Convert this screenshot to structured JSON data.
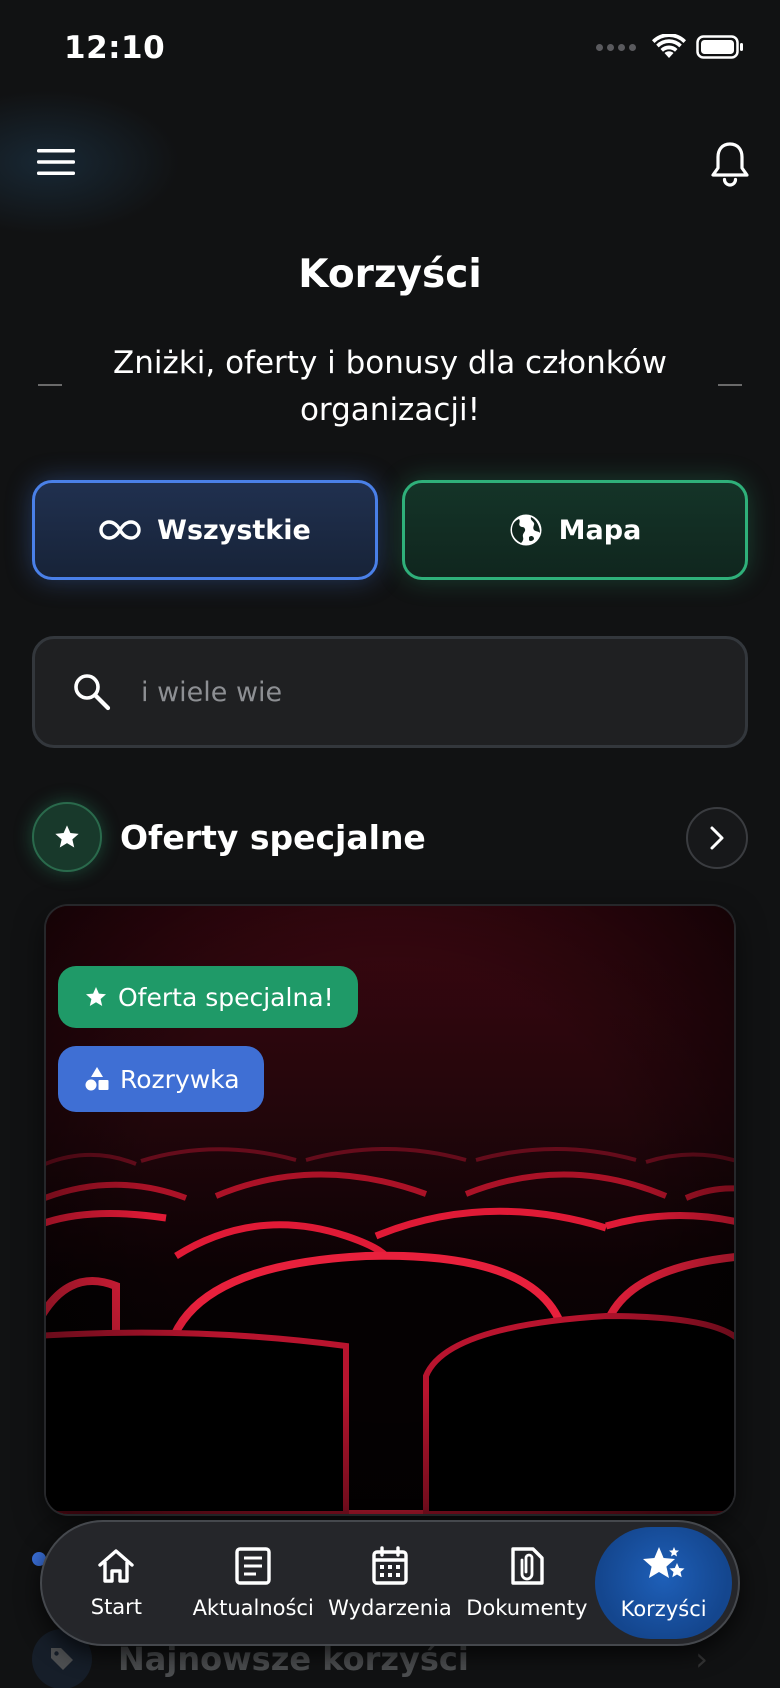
{
  "status_bar": {
    "time": "12:10"
  },
  "header": {
    "title": "Korzyści",
    "subtitle": "Zniżki, oferty i bonusy dla członków organizacji!"
  },
  "filters": {
    "all_label": "Wszystkie",
    "map_label": "Mapa"
  },
  "search": {
    "placeholder": "i wiele wie"
  },
  "special_section": {
    "title": "Oferty specjalne"
  },
  "offer_card": {
    "badge_special": "Oferta specjalna!",
    "badge_category": "Rozrywka",
    "category_icon": "shapes-icon",
    "image": "cinema-seats-red"
  },
  "next_section": {
    "title": "Najnowsze korzyści"
  },
  "nav": {
    "items": [
      {
        "label": "Start",
        "icon": "home-icon"
      },
      {
        "label": "Aktualności",
        "icon": "news-icon"
      },
      {
        "label": "Wydarzenia",
        "icon": "calendar-icon"
      },
      {
        "label": "Dokumenty",
        "icon": "document-icon"
      },
      {
        "label": "Korzyści",
        "icon": "stars-icon"
      }
    ],
    "active_index": 4
  },
  "colors": {
    "background": "#111213",
    "accent_blue": "#4a80e8",
    "accent_green": "#2fb07a",
    "badge_green": "#1f9a68",
    "badge_blue": "#3f6fd4",
    "nav_active": "#14468e"
  }
}
